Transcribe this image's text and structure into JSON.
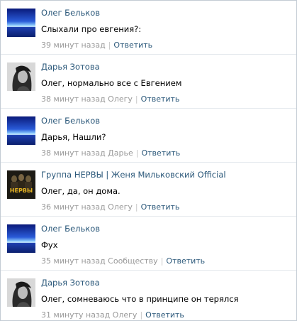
{
  "comments": [
    {
      "author": "Олег Бельков",
      "avatar": "sea-landscape-avatar",
      "text": "Слыхали про евгения?:",
      "time": "39 минут назад",
      "reply_label": "Ответить"
    },
    {
      "author": "Дарья Зотова",
      "avatar": "woman-portrait-avatar",
      "text": "Олег, нормально все с Евгением",
      "time": "38 минут назад Олегу",
      "reply_label": "Ответить"
    },
    {
      "author": "Олег Бельков",
      "avatar": "sea-landscape-avatar",
      "text": "Дарья, Нашли?",
      "time": "38 минут назад Дарье",
      "reply_label": "Ответить"
    },
    {
      "author": "Группа НЕРВЫ | Женя Мильковский Official",
      "avatar": "band-nervy-avatar",
      "avatar_logo_text": "НЕРВЫ",
      "text": "Олег, да, он дома.",
      "time": "36 минут назад Олегу",
      "reply_label": "Ответить"
    },
    {
      "author": "Олег Бельков",
      "avatar": "sea-landscape-avatar",
      "text": "Фух",
      "time": "35 минут назад Сообществу",
      "reply_label": "Ответить"
    },
    {
      "author": "Дарья Зотова",
      "avatar": "woman-portrait-avatar",
      "text": "Олег, сомневаюсь что в принципе он терялся",
      "time": "31 минуту назад Олегу",
      "reply_label": "Ответить"
    }
  ],
  "colors": {
    "link": "#2b587a",
    "meta": "#999999",
    "divider": "#e4e8ed",
    "border": "#c3cbd4"
  }
}
